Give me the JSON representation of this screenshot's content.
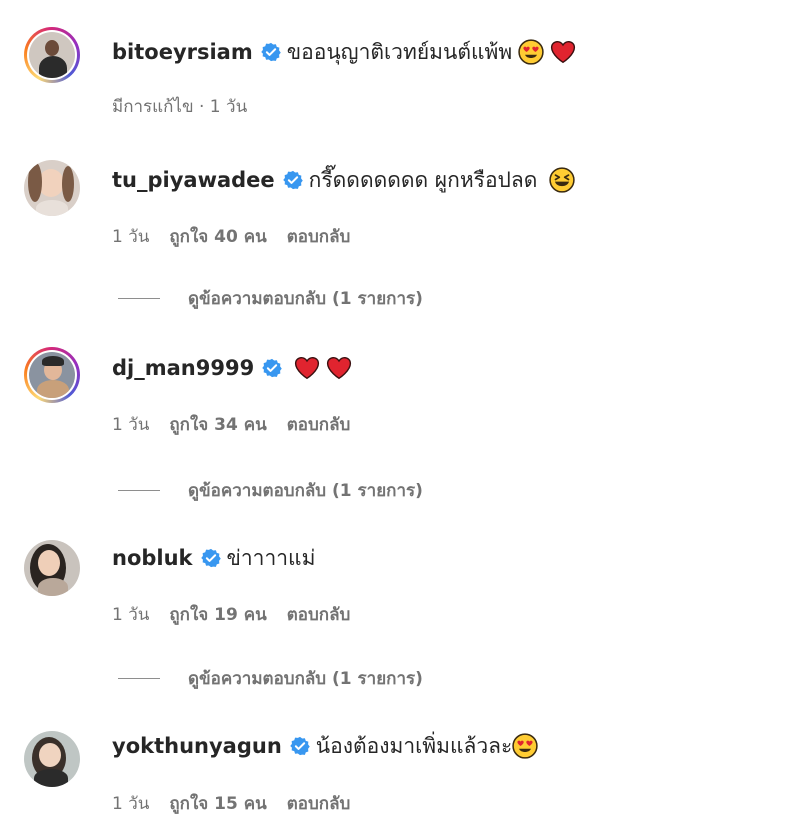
{
  "comments": [
    {
      "username": "bitoeyrsiam",
      "text": "ขออนุญาติเวทย์มนต์แพ้พ",
      "emojis": [
        "heart-eyes-emoji",
        "red-heart-emoji"
      ],
      "meta_time": "มีการแก้ไข · 1 วัน",
      "likes": "",
      "reply": "",
      "view_replies": "",
      "ring": true
    },
    {
      "username": "tu_piyawadee",
      "text": "กรี๊ดดดดดดด ผูกหรือปลด",
      "emojis": [
        "grinning-squint-emoji"
      ],
      "meta_time": "1 วัน",
      "likes": "ถูกใจ 40 คน",
      "reply": "ตอบกลับ",
      "view_replies": "ดูข้อความตอบกลับ (1 รายการ)",
      "ring": false
    },
    {
      "username": "dj_man9999",
      "text": "",
      "emojis": [
        "red-heart-emoji",
        "red-heart-emoji"
      ],
      "meta_time": "1 วัน",
      "likes": "ถูกใจ 34 คน",
      "reply": "ตอบกลับ",
      "view_replies": "ดูข้อความตอบกลับ (1 รายการ)",
      "ring": true
    },
    {
      "username": "nobluk",
      "text": "ข่าาาาแม่",
      "emojis": [],
      "meta_time": "1 วัน",
      "likes": "ถูกใจ 19 คน",
      "reply": "ตอบกลับ",
      "view_replies": "ดูข้อความตอบกลับ (1 รายการ)",
      "ring": false
    },
    {
      "username": "yokthunyagun",
      "text": "น้องต้องมาเพิ่มแล้วละ",
      "emojis": [
        "heart-eyes-emoji"
      ],
      "meta_time": "1 วัน",
      "likes": "ถูกใจ 15 คน",
      "reply": "ตอบกลับ",
      "view_replies": "",
      "ring": false
    }
  ],
  "colors": {
    "verified": "#3897f0",
    "meta_text": "#737373",
    "primary_text": "#262626"
  }
}
